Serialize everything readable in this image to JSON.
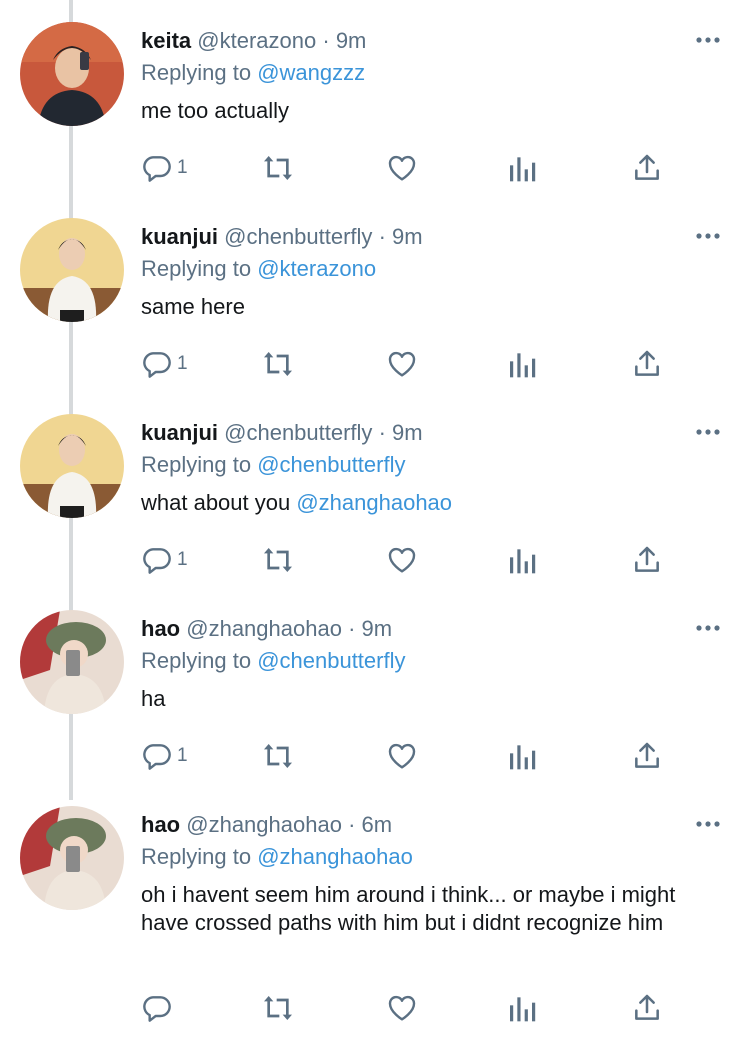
{
  "colors": {
    "secondary_text": "#5b7083",
    "link": "#3b94d9",
    "thread_line": "#d6d9db"
  },
  "tweets": [
    {
      "name": "keita",
      "handle": "@kterazono",
      "dot": "·",
      "time": "9m",
      "replying_prefix": "Replying to ",
      "replying_to": "@wangzzz",
      "text_parts": [
        "me too actually",
        ""
      ],
      "reply_count": "1"
    },
    {
      "name": "kuanjui",
      "handle": "@chenbutterfly",
      "dot": "·",
      "time": "9m",
      "replying_prefix": "Replying to ",
      "replying_to": "@kterazono",
      "text_parts": [
        "same here",
        ""
      ],
      "reply_count": "1"
    },
    {
      "name": "kuanjui",
      "handle": "@chenbutterfly",
      "dot": "·",
      "time": "9m",
      "replying_prefix": "Replying to ",
      "replying_to": "@chenbutterfly",
      "text_parts": [
        "what about you ",
        "@zhanghaohao"
      ],
      "reply_count": "1"
    },
    {
      "name": "hao",
      "handle": "@zhanghaohao",
      "dot": "·",
      "time": "9m",
      "replying_prefix": "Replying to ",
      "replying_to": "@chenbutterfly",
      "text_parts": [
        "ha",
        ""
      ],
      "reply_count": "1"
    },
    {
      "name": "hao",
      "handle": "@zhanghaohao",
      "dot": "·",
      "time": "6m",
      "replying_prefix": "Replying to ",
      "replying_to": "@zhanghaohao",
      "text_parts": [
        "oh i havent seem him around i think... or maybe i might have crossed paths with him but i didnt recognize him",
        ""
      ],
      "reply_count": ""
    }
  ]
}
